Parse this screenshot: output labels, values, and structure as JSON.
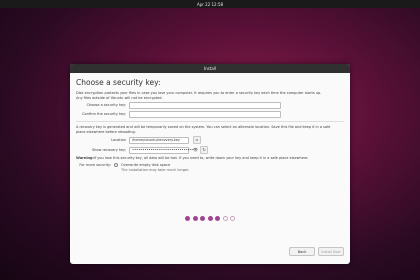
{
  "topbar": {
    "clock": "Apr 22  12:58"
  },
  "window": {
    "title": "Install"
  },
  "page": {
    "heading": "Choose a security key:",
    "intro_line1": "Disk encryption protects your files in case you lose your computer. It requires you to enter a security key each time the computer starts up.",
    "intro_line2": "Any files outside of Ubuntu will not be encrypted.",
    "security_key_label": "Choose a security key:",
    "confirm_key_label": "Confirm the security key:",
    "recovery_text_line1": "A recovery key is generated and will be temporarily saved on the system. You can select an alternate location. Save this file and keep it in a safe",
    "recovery_text_line2": "place elsewhere before rebooting.",
    "location_label": "Location",
    "location_value": "/home/ubuntu/recovery.key",
    "show_recovery_label": "Show recovery key:",
    "recovery_key_value": "••••••••••••••••••••••••••••••",
    "warning_bold": "Warning:",
    "warning_text": " If you lose this security key, all data will be lost. If you need to, write down your key and keep it in a safe place elsewhere.",
    "for_more_security_label": "For more security:",
    "overwrite_option": "Overwrite empty disk space",
    "overwrite_note": "The installation may take much longer."
  },
  "buttons": {
    "back": "Back",
    "install_now": "Install Now"
  },
  "progress": {
    "total_steps": 7,
    "current_step": 5
  },
  "colors": {
    "accent": "#a0458f",
    "titlebar": "#303030"
  }
}
